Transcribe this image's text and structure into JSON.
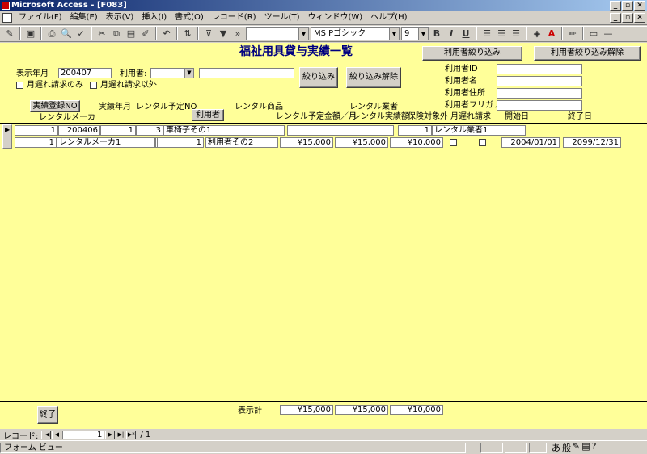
{
  "window": {
    "title": "Microsoft Access - [F083]",
    "min": "_",
    "max": "▫",
    "close": "✕"
  },
  "menu": {
    "items": [
      "ファイル(F)",
      "編集(E)",
      "表示(V)",
      "挿入(I)",
      "書式(O)",
      "レコード(R)",
      "ツール(T)",
      "ウィンドウ(W)",
      "ヘルプ(H)"
    ],
    "min": "_",
    "max": "▫",
    "close": "✕"
  },
  "toolbar": {
    "font": "MS Pゴシック",
    "size": "9",
    "bold": "B",
    "italic": "I",
    "underline": "U"
  },
  "form": {
    "title": "福祉用具貸与実績一覧",
    "filter": {
      "month_label": "表示年月",
      "month_value": "200407",
      "user_label": "利用者:",
      "user_value": "",
      "late_only_label": "月遅れ請求のみ",
      "late_except_label": "月遅れ請求以外",
      "filter_button": "絞り込み",
      "clear_button": "絞り込み解除",
      "user_filter_button": "利用者絞り込み",
      "user_filter_clear_button": "利用者絞り込み解除",
      "user_id_label": "利用者ID",
      "user_name_label": "利用者名",
      "user_address_label": "利用者住所",
      "user_kana_label": "利用者フリガナ",
      "user_id_value": "",
      "user_name_value": "",
      "user_address_value": "",
      "user_kana_value": ""
    },
    "headers": {
      "record_no_button": "実績登録NO",
      "month": "実績年月",
      "plan_no": "レンタル予定NO",
      "user_button": "利用者",
      "product": "レンタル商品",
      "vendor": "レンタル業者",
      "maker": "レンタルメーカ",
      "plan_amount": "レンタル予定金額／月",
      "actual_amount": "レンタル実績額",
      "insurance_exclusion": "保険対象外",
      "late_billing": "月遅れ請求",
      "start_date": "開始日",
      "end_date": "終了日"
    },
    "record": {
      "record_no": "1",
      "month": "200406",
      "plan_no": "1",
      "user_id": "3",
      "product": "車椅子その1",
      "product_extra": "",
      "vendor_no": "1",
      "vendor": "レンタル業者1",
      "maker_no": "1",
      "maker": "レンタルメーカ1",
      "blank": "",
      "user_no": "1",
      "user_name": "利用者その2",
      "plan_amount": "¥15,000",
      "actual_amount": "¥15,000",
      "insurance_exclusion_amount": "¥10,000",
      "start_date": "2004/01/01",
      "end_date": "2099/12/31"
    },
    "footer": {
      "exit_button": "終了",
      "total_label": "表示計",
      "total_plan": "¥15,000",
      "total_actual": "¥15,000",
      "total_exclusion": "¥10,000"
    }
  },
  "nav": {
    "label": "レコード:",
    "current": "1",
    "of": "/ 1"
  },
  "status": {
    "text": "フォーム ビュー"
  }
}
